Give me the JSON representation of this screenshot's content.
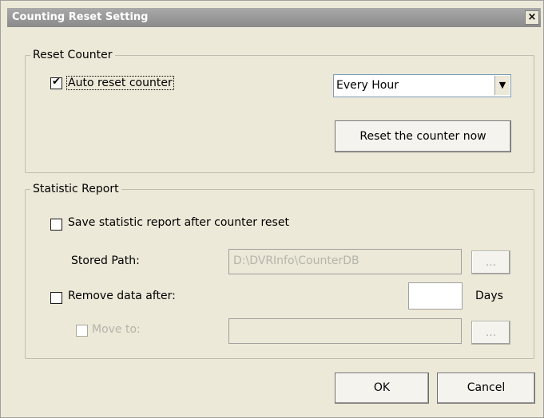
{
  "title": "Counting Reset Setting",
  "close_glyph": "×",
  "reset_counter": {
    "legend": "Reset Counter",
    "auto_reset_label": "Auto reset counter",
    "auto_reset_checked": true,
    "interval_value": "Every Hour",
    "reset_now_label": "Reset the counter now"
  },
  "statistic_report": {
    "legend": "Statistic Report",
    "save_report_label": "Save statistic report after counter reset",
    "save_report_checked": false,
    "stored_path_label": "Stored Path:",
    "stored_path_value": "D:\\DVRInfo\\CounterDB",
    "browse_label": "...",
    "remove_data_label": "Remove data after:",
    "remove_data_checked": false,
    "days_value": "",
    "days_label": "Days",
    "move_to_label": "Move to:",
    "move_to_checked": false,
    "move_to_value": "",
    "move_browse_label": "..."
  },
  "buttons": {
    "ok_label": "OK",
    "cancel_label": "Cancel"
  }
}
